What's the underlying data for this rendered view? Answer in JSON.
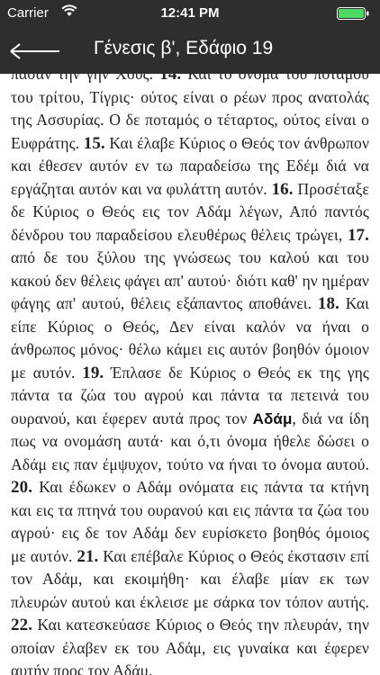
{
  "status_bar": {
    "carrier": "Carrier",
    "time": "12:41 PM",
    "battery_color": "#4cd964",
    "wifi_icon": "wifi-icon",
    "battery_icon": "battery-icon"
  },
  "nav": {
    "back_icon": "back-arrow-icon",
    "title": "Γένεσις β', Εδάφιο 19",
    "bg_color": "#2e2e2e"
  },
  "passage": {
    "v13_tail": "πάσαν την γην Χους.",
    "v14_num": "14.",
    "v14": "Και το όνομα του ποταμού του τρίτου, Τίγρις· ούτος είναι ο ρέων προς ανατολάς της Ασσυρίας. Ο δε ποταμός ο τέταρτος, ούτος είναι ο Ευφράτης.",
    "v15_num": "15.",
    "v15": "Και έλαβε Κύριος ο Θεός τον άνθρωπον και έθεσεν αυτόν εν τω παραδείσω της Εδέμ διά να εργάζηται αυτόν και να φυλάττη αυτόν.",
    "v16_num": "16.",
    "v16": "Προσέταξε δε Κύριος ο Θεός εις τον Αδάμ λέγων, Από παντός δένδρου του παραδείσου ελευθέρως θέλεις τρώγει,",
    "v17_num": "17.",
    "v17": "από δε του ξύλου της γνώσεως του καλού και του κακού δεν θέλεις φάγει απ' αυτού· διότι καθ' ην ημέραν φάγης απ' αυτού, θέλεις εξάπαντος αποθάνει.",
    "v18_num": "18.",
    "v18": "Και είπε Κύριος ο Θεός, Δεν είναι καλόν να ήναι ο άνθρωπος μόνος· θέλω κάμει εις αυτόν βοηθόν όμοιον με αυτόν.",
    "v19_num": "19.",
    "v19_a": "Έπλασε δε Κύριος ο Θεός εκ της γης πάντα τα ζώα του αγρού και πάντα τα πετεινά του ουρανού, και έφερεν αυτά προς τον",
    "v19_highlight": "Αδάμ",
    "v19_b": ", διά να ίδη πως να ονομάση αυτά· και ό,τι όνομα ήθελε δώσει ο Αδάμ εις παν έμψυχον, τούτο να ήναι το όνομα αυτού.",
    "v20_num": "20.",
    "v20": "Και έδωκεν ο Αδάμ ονόματα εις πάντα τα κτήνη και εις τα πτηνά του ουρανού και εις πάντα τα ζώα του αγρού· εις δε τον Αδάμ δεν ευρίσκετο βοηθός όμοιος με αυτόν.",
    "v21_num": "21.",
    "v21": "Και επέβαλε Κύριος ο Θεός έκστασιν επί τον Αδάμ, και εκοιμήθη· και έλαβε μίαν εκ των πλευρών αυτού και έκλεισε με σάρκα τον τόπον αυτής.",
    "v22_num": "22.",
    "v22": "Και κατεσκεύασε Κύριος ο Θεός την πλευράν, την οποίαν έλαβεν εκ του Αδάμ, εις γυναίκα και έφερεν αυτήν προς τον Αδάμ."
  }
}
